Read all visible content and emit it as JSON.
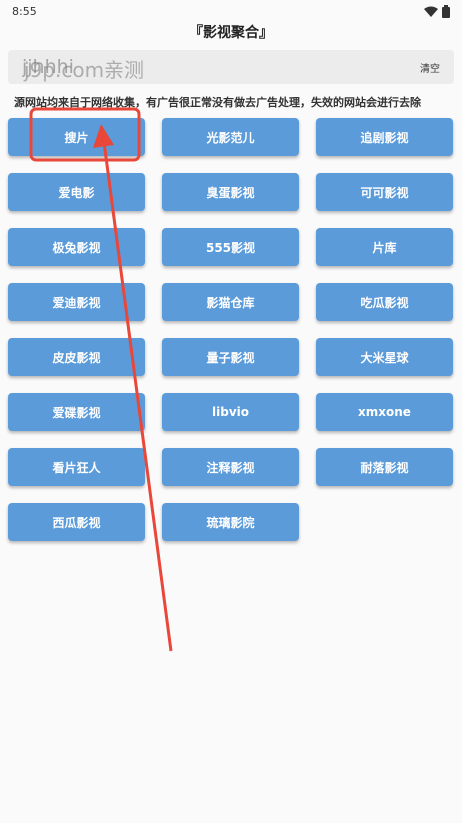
{
  "status_bar": {
    "time": "8:55",
    "icons": [
      "wifi-icon",
      "battery-icon"
    ]
  },
  "title": "『影视聚合』",
  "search": {
    "placeholder": "jjhhhi",
    "value": "",
    "clear_label": "清空"
  },
  "watermark": "j9p.com亲测",
  "notice": "源网站均来自于网络收集，有广告很正常没有做去广告处理，失效的网站会进行去除",
  "tiles": [
    "搜片",
    "光影范儿",
    "追剧影视",
    "爱电影",
    "臭蛋影视",
    "可可影视",
    "极兔影视",
    "555影视",
    "片库",
    "爱迪影视",
    "影猫仓库",
    "吃瓜影视",
    "皮皮影视",
    "量子影视",
    "大米星球",
    "爱碟影视",
    "libvio",
    "xmxone",
    "看片狂人",
    "注释影视",
    "耐落影视",
    "西瓜影视",
    "琉璃影院"
  ],
  "colors": {
    "tile": "#5b9bd9",
    "annotation": "#e8473a"
  }
}
